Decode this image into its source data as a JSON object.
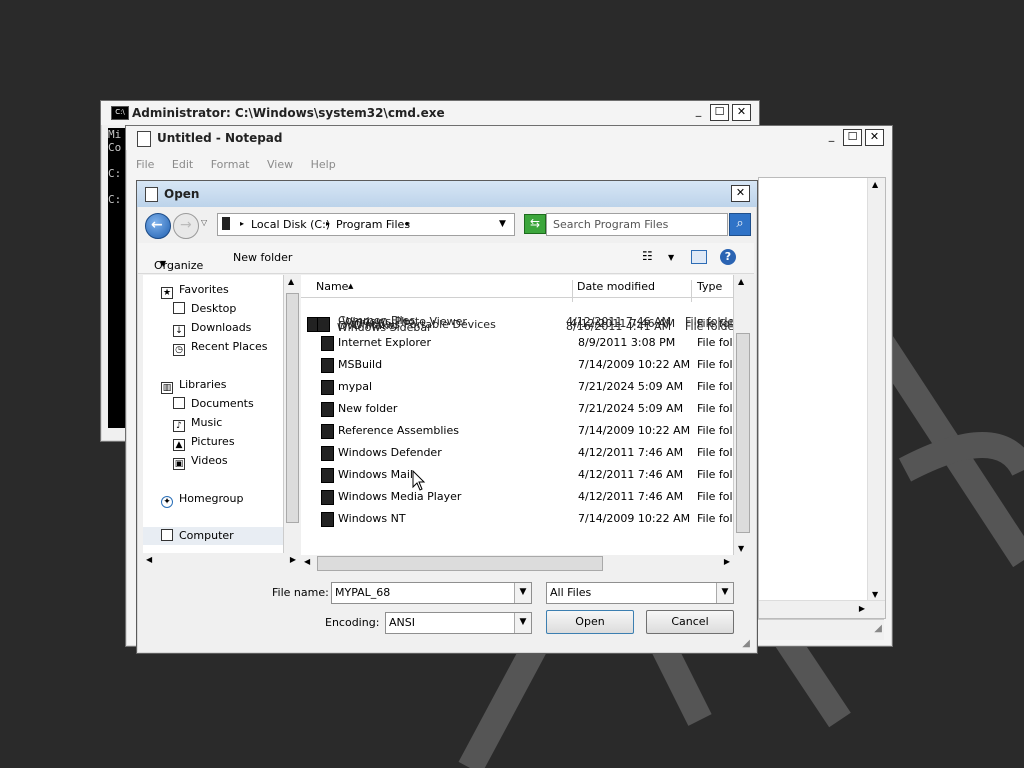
{
  "cmd": {
    "title": "Administrator: C:\\Windows\\system32\\cmd.exe",
    "lines": [
      "Mi",
      "Co",
      "",
      "C:",
      "",
      "C:"
    ]
  },
  "notepad": {
    "title": "Untitled - Notepad",
    "menu": [
      "File",
      "Edit",
      "Format",
      "View",
      "Help"
    ]
  },
  "open_dialog": {
    "title": "Open",
    "address": {
      "drive": "Local Disk (C:)",
      "folder": "Program Files"
    },
    "search_placeholder": "Search Program Files",
    "toolbar": {
      "organize": "Organize",
      "new_folder": "New folder"
    },
    "nav": {
      "favorites": "Favorites",
      "favorites_items": [
        "Desktop",
        "Downloads",
        "Recent Places"
      ],
      "libraries": "Libraries",
      "libraries_items": [
        "Documents",
        "Music",
        "Pictures",
        "Videos"
      ],
      "homegroup": "Homegroup",
      "computer": "Computer"
    },
    "columns": {
      "name": "Name",
      "date": "Date modified",
      "type": "Type"
    },
    "overlap_rows": [
      {
        "name": "Common Files",
        "date": "4/12/2011 7:46 AM",
        "type": "File folder"
      },
      {
        "name": "DVD Maker",
        "date": "8/16/2011 4:41 AM",
        "type": "File folder"
      },
      {
        "name": "Windows Photo Viewer",
        "date": "4/12/2011 7:46 AM",
        "type": "File folder"
      },
      {
        "name": "Windows Portable Devices",
        "date": "7/14/2009 10:22 AM",
        "type": "File folder"
      },
      {
        "name": "Windows Sidebar",
        "date": "4/12/2011 7:46 AM",
        "type": "File folder"
      }
    ],
    "rows": [
      {
        "name": "Internet Explorer",
        "date": "8/9/2011 3:08 PM",
        "type": "File folc"
      },
      {
        "name": "MSBuild",
        "date": "7/14/2009 10:22 AM",
        "type": "File folc"
      },
      {
        "name": "mypal",
        "date": "7/21/2024 5:09 AM",
        "type": "File folc"
      },
      {
        "name": "New folder",
        "date": "7/21/2024 5:09 AM",
        "type": "File folc"
      },
      {
        "name": "Reference Assemblies",
        "date": "7/14/2009 10:22 AM",
        "type": "File folc"
      },
      {
        "name": "Windows Defender",
        "date": "4/12/2011 7:46 AM",
        "type": "File folc"
      },
      {
        "name": "Windows Mail",
        "date": "4/12/2011 7:46 AM",
        "type": "File folc"
      },
      {
        "name": "Windows Media Player",
        "date": "4/12/2011 7:46 AM",
        "type": "File folc"
      },
      {
        "name": "Windows NT",
        "date": "7/14/2009 10:22 AM",
        "type": "File folc"
      }
    ],
    "file_name_label": "File name:",
    "file_name_value": "MYPAL_68",
    "filter_value": "All Files",
    "encoding_label": "Encoding:",
    "encoding_value": "ANSI",
    "open_button": "Open",
    "cancel_button": "Cancel"
  }
}
